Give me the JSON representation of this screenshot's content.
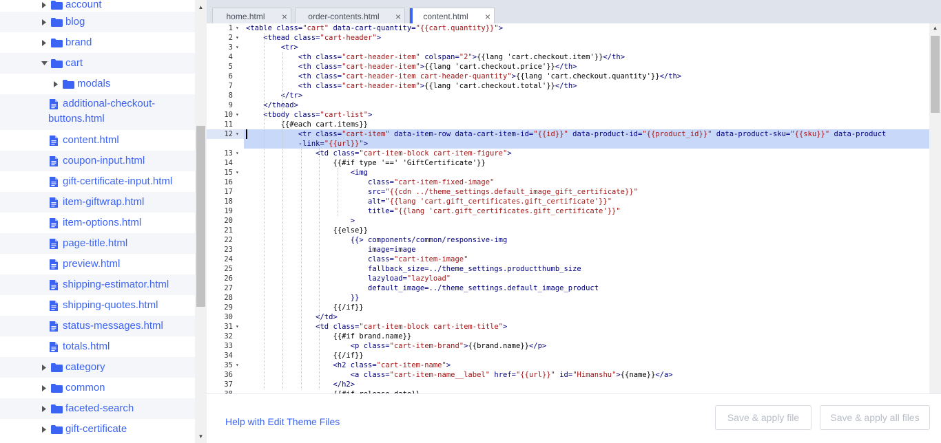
{
  "sidebar": {
    "items": [
      {
        "type": "folder",
        "label": "account",
        "expanded": false,
        "depth": 0
      },
      {
        "type": "folder",
        "label": "blog",
        "expanded": false,
        "depth": 0
      },
      {
        "type": "folder",
        "label": "brand",
        "expanded": false,
        "depth": 0
      },
      {
        "type": "folder",
        "label": "cart",
        "expanded": true,
        "depth": 0
      },
      {
        "type": "folder",
        "label": "modals",
        "expanded": false,
        "depth": 1
      },
      {
        "type": "file",
        "label": "additional-checkout-",
        "label2": "buttons.html"
      },
      {
        "type": "file",
        "label": "content.html"
      },
      {
        "type": "file",
        "label": "coupon-input.html"
      },
      {
        "type": "file",
        "label": "gift-certificate-input.html"
      },
      {
        "type": "file",
        "label": "item-giftwrap.html"
      },
      {
        "type": "file",
        "label": "item-options.html"
      },
      {
        "type": "file",
        "label": "page-title.html"
      },
      {
        "type": "file",
        "label": "preview.html"
      },
      {
        "type": "file",
        "label": "shipping-estimator.html"
      },
      {
        "type": "file",
        "label": "shipping-quotes.html"
      },
      {
        "type": "file",
        "label": "status-messages.html"
      },
      {
        "type": "file",
        "label": "totals.html"
      },
      {
        "type": "folder",
        "label": "category",
        "expanded": false,
        "depth": 0
      },
      {
        "type": "folder",
        "label": "common",
        "expanded": false,
        "depth": 0
      },
      {
        "type": "folder",
        "label": "faceted-search",
        "expanded": false,
        "depth": 0
      },
      {
        "type": "folder",
        "label": "gift-certificate",
        "expanded": false,
        "depth": 0
      }
    ]
  },
  "tabs": [
    {
      "label": "home.html",
      "active": false
    },
    {
      "label": "order-contents.html",
      "active": false
    },
    {
      "label": "content.html",
      "active": true
    }
  ],
  "code": {
    "active_line": 12,
    "lines": [
      {
        "n": "1",
        "fold": true,
        "text": "<table class=\"cart\" data-cart-quantity=\"{{cart.quantity}}\">"
      },
      {
        "n": "2",
        "fold": true,
        "text": "    <thead class=\"cart-header\">"
      },
      {
        "n": "3",
        "fold": true,
        "text": "        <tr>"
      },
      {
        "n": "4",
        "fold": false,
        "text": "            <th class=\"cart-header-item\" colspan=\"2\">{{lang 'cart.checkout.item'}}</th>"
      },
      {
        "n": "5",
        "fold": false,
        "text": "            <th class=\"cart-header-item\">{{lang 'cart.checkout.price'}}</th>"
      },
      {
        "n": "6",
        "fold": false,
        "text": "            <th class=\"cart-header-item cart-header-quantity\">{{lang 'cart.checkout.quantity'}}</th>"
      },
      {
        "n": "7",
        "fold": false,
        "text": "            <th class=\"cart-header-item\">{{lang 'cart.checkout.total'}}</th>"
      },
      {
        "n": "8",
        "fold": false,
        "text": "        </tr>"
      },
      {
        "n": "9",
        "fold": false,
        "text": "    </thead>"
      },
      {
        "n": "10",
        "fold": true,
        "text": "    <tbody class=\"cart-list\">"
      },
      {
        "n": "11",
        "fold": false,
        "text": "        {{#each cart.items}}"
      },
      {
        "n": "12",
        "fold": true,
        "text": "            <tr class=\"cart-item\" data-item-row data-cart-item-id=\"{{id}}\" data-product-id=\"{{product_id}}\" data-product-sku=\"{{sku}}\" data-product"
      },
      {
        "n": "",
        "fold": false,
        "text": "            -link=\"{{url}}\">"
      },
      {
        "n": "13",
        "fold": true,
        "text": "                <td class=\"cart-item-block cart-item-figure\">"
      },
      {
        "n": "14",
        "fold": false,
        "text": "                    {{#if type '==' 'GiftCertificate'}}"
      },
      {
        "n": "15",
        "fold": true,
        "text": "                        <img"
      },
      {
        "n": "16",
        "fold": false,
        "text": "                            class=\"cart-item-fixed-image\""
      },
      {
        "n": "17",
        "fold": false,
        "text": "                            src=\"{{cdn ../theme_settings.default_image_gift_certificate}}\""
      },
      {
        "n": "18",
        "fold": false,
        "text": "                            alt=\"{{lang 'cart.gift_certificates.gift_certificate'}}\""
      },
      {
        "n": "19",
        "fold": false,
        "text": "                            title=\"{{lang 'cart.gift_certificates.gift_certificate'}}\""
      },
      {
        "n": "20",
        "fold": false,
        "text": "                        >"
      },
      {
        "n": "21",
        "fold": false,
        "text": "                    {{else}}"
      },
      {
        "n": "22",
        "fold": false,
        "text": "                        {{> components/common/responsive-img"
      },
      {
        "n": "23",
        "fold": false,
        "text": "                            image=image"
      },
      {
        "n": "24",
        "fold": false,
        "text": "                            class=\"cart-item-image\""
      },
      {
        "n": "25",
        "fold": false,
        "text": "                            fallback_size=../theme_settings.productthumb_size"
      },
      {
        "n": "26",
        "fold": false,
        "text": "                            lazyload=\"lazyload\""
      },
      {
        "n": "27",
        "fold": false,
        "text": "                            default_image=../theme_settings.default_image_product"
      },
      {
        "n": "28",
        "fold": false,
        "text": "                        }}"
      },
      {
        "n": "29",
        "fold": false,
        "text": "                    {{/if}}"
      },
      {
        "n": "30",
        "fold": false,
        "text": "                </td>"
      },
      {
        "n": "31",
        "fold": true,
        "text": "                <td class=\"cart-item-block cart-item-title\">"
      },
      {
        "n": "32",
        "fold": false,
        "text": "                    {{#if brand.name}}"
      },
      {
        "n": "33",
        "fold": false,
        "text": "                        <p class=\"cart-item-brand\">{{brand.name}}</p>"
      },
      {
        "n": "34",
        "fold": false,
        "text": "                    {{/if}}"
      },
      {
        "n": "35",
        "fold": true,
        "text": "                    <h2 class=\"cart-item-name\">"
      },
      {
        "n": "36",
        "fold": false,
        "text": "                        <a class=\"cart-item-name__label\" href=\"{{url}}\" id=\"Himanshu\">{{name}}</a>"
      },
      {
        "n": "37",
        "fold": false,
        "text": "                    </h2>"
      },
      {
        "n": "38",
        "fold": false,
        "text": "                    {{#if release_date}}"
      }
    ]
  },
  "footer": {
    "help_link": "Help with Edit Theme Files",
    "save_apply": "Save & apply file",
    "save_apply_all": "Save & apply all files"
  },
  "colors": {
    "accent": "#3c64f4",
    "highlight": "#c8d8f8"
  }
}
